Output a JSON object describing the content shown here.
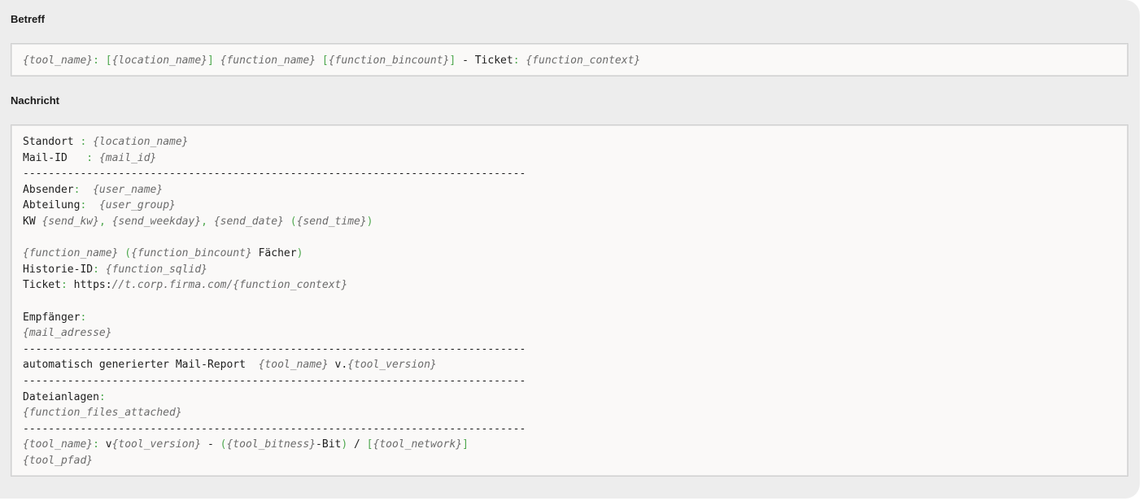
{
  "subject": {
    "label": "Betreff",
    "tokens": [
      {
        "k": "v",
        "s": "{tool_name}"
      },
      {
        "k": "p",
        "s": ": "
      },
      {
        "k": "p",
        "s": "["
      },
      {
        "k": "v",
        "s": "{location_name}"
      },
      {
        "k": "p",
        "s": "]"
      },
      {
        "k": "t",
        "s": " "
      },
      {
        "k": "v",
        "s": "{function_name}"
      },
      {
        "k": "t",
        "s": " "
      },
      {
        "k": "p",
        "s": "["
      },
      {
        "k": "v",
        "s": "{function_bincount}"
      },
      {
        "k": "p",
        "s": "]"
      },
      {
        "k": "t",
        "s": " - Ticket"
      },
      {
        "k": "p",
        "s": ": "
      },
      {
        "k": "v",
        "s": "{function_context}"
      }
    ]
  },
  "message": {
    "label": "Nachricht",
    "lines": [
      [
        {
          "k": "t",
          "s": "Standort "
        },
        {
          "k": "p",
          "s": ": "
        },
        {
          "k": "v",
          "s": "{location_name}"
        }
      ],
      [
        {
          "k": "t",
          "s": "Mail-ID   "
        },
        {
          "k": "p",
          "s": ": "
        },
        {
          "k": "v",
          "s": "{mail_id}"
        }
      ],
      [
        {
          "k": "sep",
          "s": "-------------------------------------------------------------------------------"
        }
      ],
      [
        {
          "k": "t",
          "s": "Absender"
        },
        {
          "k": "p",
          "s": ":  "
        },
        {
          "k": "v",
          "s": "{user_name}"
        }
      ],
      [
        {
          "k": "t",
          "s": "Abteilung"
        },
        {
          "k": "p",
          "s": ":  "
        },
        {
          "k": "v",
          "s": "{user_group}"
        }
      ],
      [
        {
          "k": "t",
          "s": "KW "
        },
        {
          "k": "v",
          "s": "{send_kw}"
        },
        {
          "k": "p",
          "s": ", "
        },
        {
          "k": "v",
          "s": "{send_weekday}"
        },
        {
          "k": "p",
          "s": ", "
        },
        {
          "k": "v",
          "s": "{send_date}"
        },
        {
          "k": "t",
          "s": " "
        },
        {
          "k": "p",
          "s": "("
        },
        {
          "k": "v",
          "s": "{send_time}"
        },
        {
          "k": "p",
          "s": ")"
        }
      ],
      [],
      [
        {
          "k": "v",
          "s": "{function_name}"
        },
        {
          "k": "t",
          "s": " "
        },
        {
          "k": "p",
          "s": "("
        },
        {
          "k": "v",
          "s": "{function_bincount}"
        },
        {
          "k": "t",
          "s": " Fächer"
        },
        {
          "k": "p",
          "s": ")"
        }
      ],
      [
        {
          "k": "t",
          "s": "Historie-ID"
        },
        {
          "k": "p",
          "s": ": "
        },
        {
          "k": "v",
          "s": "{function_sqlid}"
        }
      ],
      [
        {
          "k": "t",
          "s": "Ticket"
        },
        {
          "k": "p",
          "s": ": "
        },
        {
          "k": "t",
          "s": "https:"
        },
        {
          "k": "v",
          "s": "//t.corp.firma.com/{function_context}"
        }
      ],
      [],
      [
        {
          "k": "t",
          "s": "Empfänger"
        },
        {
          "k": "p",
          "s": ":"
        }
      ],
      [
        {
          "k": "v",
          "s": "{mail_adresse}"
        }
      ],
      [
        {
          "k": "sep",
          "s": "-------------------------------------------------------------------------------"
        }
      ],
      [
        {
          "k": "t",
          "s": "automatisch generierter Mail-Report  "
        },
        {
          "k": "v",
          "s": "{tool_name}"
        },
        {
          "k": "t",
          "s": " v."
        },
        {
          "k": "v",
          "s": "{tool_version}"
        }
      ],
      [
        {
          "k": "sep",
          "s": "-------------------------------------------------------------------------------"
        }
      ],
      [
        {
          "k": "t",
          "s": "Dateianlagen"
        },
        {
          "k": "p",
          "s": ":"
        }
      ],
      [
        {
          "k": "v",
          "s": "{function_files_attached}"
        }
      ],
      [
        {
          "k": "sep",
          "s": "-------------------------------------------------------------------------------"
        }
      ],
      [
        {
          "k": "v",
          "s": "{tool_name}"
        },
        {
          "k": "p",
          "s": ":"
        },
        {
          "k": "t",
          "s": " v"
        },
        {
          "k": "v",
          "s": "{tool_version}"
        },
        {
          "k": "t",
          "s": " - "
        },
        {
          "k": "p",
          "s": "("
        },
        {
          "k": "v",
          "s": "{tool_bitness}"
        },
        {
          "k": "t",
          "s": "-Bit"
        },
        {
          "k": "p",
          "s": ")"
        },
        {
          "k": "t",
          "s": " / "
        },
        {
          "k": "p",
          "s": "["
        },
        {
          "k": "v",
          "s": "{tool_network}"
        },
        {
          "k": "p",
          "s": "]"
        }
      ],
      [
        {
          "k": "v",
          "s": "{tool_pfad}"
        }
      ]
    ]
  },
  "colors": {
    "background": "#ededed",
    "field": "#faf9f8",
    "placeholder": "#6b6b6b",
    "punctuation": "#4fa84f",
    "text": "#1e1e1e"
  }
}
